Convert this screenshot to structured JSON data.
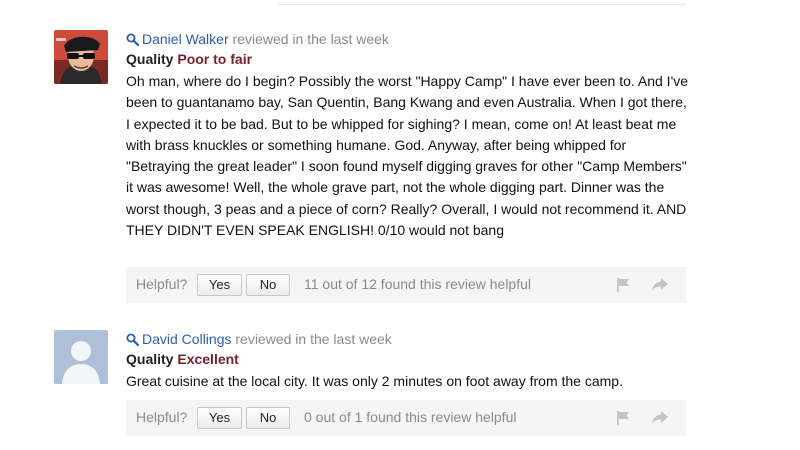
{
  "reviews": [
    {
      "reviewer": "Daniel Walker",
      "reviewed_when": "reviewed in the last week",
      "quality_label": "Quality",
      "quality_value": "Poor to fair",
      "text": "Oh man, where do I begin? Possibly the worst \"Happy Camp\" I have ever been to. And I've been to guantanamo bay, San Quentin, Bang Kwang and even Australia. When I got there, I expected it to be bad. But to be whipped for sighing? I mean, come on! At least beat me with brass knuckles or something humane. God. Anyway, after being whipped for \"Betraying the great leader\" I soon found myself digging graves for other \"Camp Members\" it was awesome! Well, the whole grave part, not the whole digging part. Dinner was the worst though, 3 peas and a piece of corn? Really? Overall, I would not recommend it. AND THEY DIDN'T EVEN SPEAK ENGLISH! 0/10 would not bang",
      "helpful_label": "Helpful?",
      "yes_label": "Yes",
      "no_label": "No",
      "helpful_count": "11 out of 12 found this review helpful"
    },
    {
      "reviewer": "David Collings",
      "reviewed_when": "reviewed in the last week",
      "quality_label": "Quality",
      "quality_value": "Excellent",
      "text": "Great cuisine at the local city. It was only 2 minutes on foot away from the camp.",
      "helpful_label": "Helpful?",
      "yes_label": "Yes",
      "no_label": "No",
      "helpful_count": "0 out of 1 found this review helpful"
    }
  ],
  "icons": {
    "search": "magnifier-icon",
    "flag": "flag-icon",
    "share": "share-arrow-icon",
    "avatar_1": "user-photo-avatar",
    "avatar_2": "default-user-silhouette"
  },
  "colors": {
    "reviewer_link": "#2a5db0",
    "quality_value": "#7a1f2a",
    "muted": "#8a8a8a",
    "helpful_bar_bg": "#f5f5f5",
    "avatar_placeholder": "#aebfd8"
  }
}
